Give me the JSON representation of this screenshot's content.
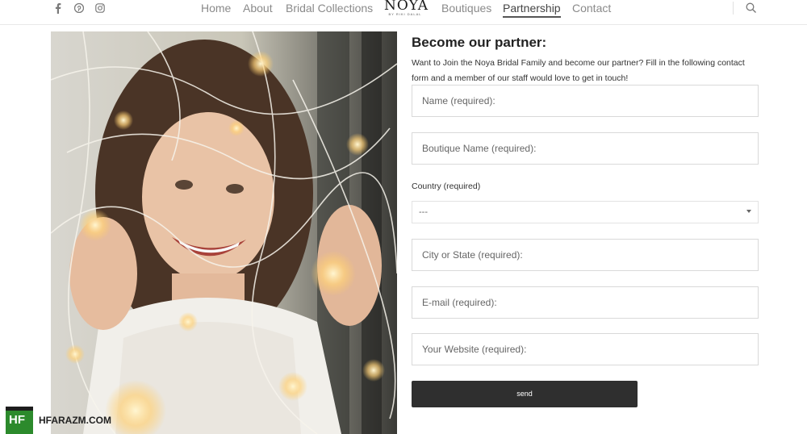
{
  "header": {
    "social": [
      {
        "icon": "facebook-icon",
        "glyph": "f"
      },
      {
        "icon": "pinterest-icon",
        "glyph": "P"
      },
      {
        "icon": "instagram-icon",
        "glyph": "◎"
      }
    ],
    "nav": {
      "home": "Home",
      "about": "About",
      "bridal": "Bridal Collections",
      "boutiques": "Boutiques",
      "partnership": "Partnership",
      "contact": "Contact"
    },
    "logo": {
      "mark": "NOYA",
      "sub": "BY RIKI DALAL"
    }
  },
  "form": {
    "title": "Become our partner:",
    "intro": "Want to Join the Noya Bridal Family and become our partner? Fill in the following contact form and a member of our staff would love to get in touch!",
    "name_placeholder": "Name (required):",
    "boutique_placeholder": "Boutique Name (required):",
    "country_label": "Country (required)",
    "country_value": "---",
    "city_placeholder": "City or State (required):",
    "email_placeholder": "E-mail (required):",
    "website_placeholder": "Your Website (required):",
    "send_label": "send"
  },
  "watermark": {
    "badge": "HF",
    "text": "HFARAZM.COM"
  },
  "colors": {
    "button": "#2f2f2f",
    "accent": "#2c8a2c"
  }
}
